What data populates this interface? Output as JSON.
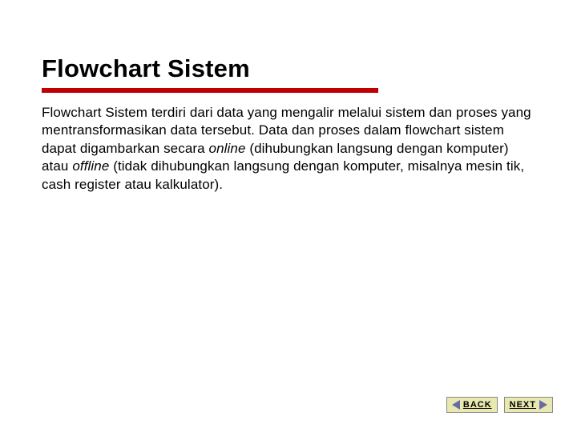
{
  "slide": {
    "title": "Flowchart Sistem",
    "body_pre_online": "Flowchart Sistem terdiri dari data yang mengalir melalui sistem dan proses yang mentransformasikan data tersebut. Data dan proses dalam flowchart sistem dapat digambarkan secara ",
    "italic_online": "online",
    "body_mid": " (dihubungkan langsung dengan komputer) atau ",
    "italic_offline": "offline",
    "body_post": " (tidak dihubungkan langsung dengan komputer, misalnya mesin tik, cash register atau kalkulator)."
  },
  "nav": {
    "back_label": "BACK",
    "next_label": "NEXT"
  },
  "colors": {
    "accent_underline": "#c00000",
    "nav_bg": "#e8e8b0",
    "arrow": "#6a6aa8"
  }
}
